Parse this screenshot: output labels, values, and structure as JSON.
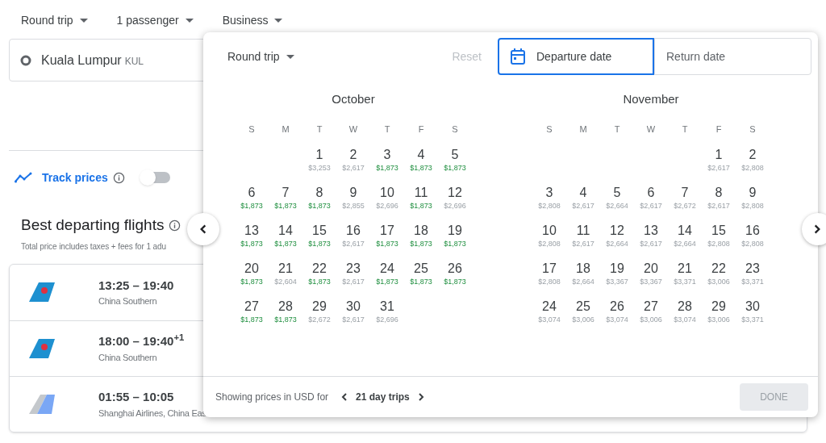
{
  "top_bar": [
    {
      "label": "Round trip"
    },
    {
      "label": "1 passenger"
    },
    {
      "label": "Business"
    }
  ],
  "origin": {
    "city": "Kuala Lumpur",
    "code": "KUL"
  },
  "track_prices": {
    "label": "Track prices",
    "on": false
  },
  "best_flights": {
    "title": "Best departing flights",
    "subtitle": "Total price includes taxes + fees for 1 adu",
    "flights": [
      {
        "times": "13:25 – 19:40",
        "airline": "China Southern",
        "kind": "blue_tail"
      },
      {
        "times": "18:00 – 19:40$^{+1}$",
        "airline": "China Southern",
        "kind": "blue_tail"
      },
      {
        "times": "01:55 – 10:05",
        "airline": "Shanghai Airlines, China Eas",
        "kind": "grey_tail"
      }
    ]
  },
  "date_picker": {
    "trip_type": "Round trip",
    "reset": {
      "label": "Reset",
      "disabled": true
    },
    "fields": [
      {
        "placeholder": "Departure date",
        "selected": true
      },
      {
        "placeholder": "Return date",
        "selected": false
      }
    ],
    "months": [
      {
        "name": "October",
        "weekdays": [
          "S",
          "M",
          "T",
          "W",
          "T",
          "F",
          "S"
        ],
        "weeks": [
          [
            {
              "kind": "blank"
            },
            {
              "kind": "blank"
            },
            {
              "kind": "day",
              "day": "1",
              "price": "$3,253",
              "cheap": false
            },
            {
              "kind": "day",
              "day": "2",
              "price": "$2,617",
              "cheap": false
            },
            {
              "kind": "day",
              "day": "3",
              "price": "$1,873",
              "cheap": true
            },
            {
              "kind": "day",
              "day": "4",
              "price": "$1,873",
              "cheap": true
            },
            {
              "kind": "day",
              "day": "5",
              "price": "$1,873",
              "cheap": true
            }
          ],
          [
            {
              "kind": "day",
              "day": "6",
              "price": "$1,873",
              "cheap": true
            },
            {
              "kind": "day",
              "day": "7",
              "price": "$1,873",
              "cheap": true
            },
            {
              "kind": "day",
              "day": "8",
              "price": "$1,873",
              "cheap": true
            },
            {
              "kind": "day",
              "day": "9",
              "price": "$2,855",
              "cheap": false
            },
            {
              "kind": "day",
              "day": "10",
              "price": "$2,696",
              "cheap": false
            },
            {
              "kind": "day",
              "day": "11",
              "price": "$1,873",
              "cheap": true
            },
            {
              "kind": "day",
              "day": "12",
              "price": "$2,696",
              "cheap": false
            }
          ],
          [
            {
              "kind": "day",
              "day": "13",
              "price": "$1,873",
              "cheap": true
            },
            {
              "kind": "day",
              "day": "14",
              "price": "$1,873",
              "cheap": true
            },
            {
              "kind": "day",
              "day": "15",
              "price": "$1,873",
              "cheap": true
            },
            {
              "kind": "day",
              "day": "16",
              "price": "$2,617",
              "cheap": false
            },
            {
              "kind": "day",
              "day": "17",
              "price": "$1,873",
              "cheap": true
            },
            {
              "kind": "day",
              "day": "18",
              "price": "$1,873",
              "cheap": true
            },
            {
              "kind": "day",
              "day": "19",
              "price": "$1,873",
              "cheap": true
            }
          ],
          [
            {
              "kind": "day",
              "day": "20",
              "price": "$1,873",
              "cheap": true
            },
            {
              "kind": "day",
              "day": "21",
              "price": "$2,604",
              "cheap": false
            },
            {
              "kind": "day",
              "day": "22",
              "price": "$1,873",
              "cheap": true
            },
            {
              "kind": "day",
              "day": "23",
              "price": "$2,617",
              "cheap": false
            },
            {
              "kind": "day",
              "day": "24",
              "price": "$1,873",
              "cheap": true
            },
            {
              "kind": "day",
              "day": "25",
              "price": "$1,873",
              "cheap": true
            },
            {
              "kind": "day",
              "day": "26",
              "price": "$1,873",
              "cheap": true
            }
          ],
          [
            {
              "kind": "day",
              "day": "27",
              "price": "$1,873",
              "cheap": true
            },
            {
              "kind": "day",
              "day": "28",
              "price": "$1,873",
              "cheap": true
            },
            {
              "kind": "day",
              "day": "29",
              "price": "$2,672",
              "cheap": false
            },
            {
              "kind": "day",
              "day": "30",
              "price": "$2,617",
              "cheap": false
            },
            {
              "kind": "day",
              "day": "31",
              "price": "$2,696",
              "cheap": false
            }
          ]
        ]
      },
      {
        "name": "November",
        "weekdays": [
          "S",
          "M",
          "T",
          "W",
          "T",
          "F",
          "S"
        ],
        "weeks": [
          [
            {
              "kind": "blank"
            },
            {
              "kind": "blank"
            },
            {
              "kind": "blank"
            },
            {
              "kind": "blank"
            },
            {
              "kind": "blank"
            },
            {
              "kind": "day",
              "day": "1",
              "price": "$2,617",
              "cheap": false
            },
            {
              "kind": "day",
              "day": "2",
              "price": "$2,808",
              "cheap": false
            }
          ],
          [
            {
              "kind": "day",
              "day": "3",
              "price": "$2,808",
              "cheap": false
            },
            {
              "kind": "day",
              "day": "4",
              "price": "$2,617",
              "cheap": false
            },
            {
              "kind": "day",
              "day": "5",
              "price": "$2,664",
              "cheap": false
            },
            {
              "kind": "day",
              "day": "6",
              "price": "$2,617",
              "cheap": false
            },
            {
              "kind": "day",
              "day": "7",
              "price": "$2,672",
              "cheap": false
            },
            {
              "kind": "day",
              "day": "8",
              "price": "$2,617",
              "cheap": false
            },
            {
              "kind": "day",
              "day": "9",
              "price": "$2,808",
              "cheap": false
            }
          ],
          [
            {
              "kind": "day",
              "day": "10",
              "price": "$2,808",
              "cheap": false
            },
            {
              "kind": "day",
              "day": "11",
              "price": "$2,617",
              "cheap": false
            },
            {
              "kind": "day",
              "day": "12",
              "price": "$2,664",
              "cheap": false
            },
            {
              "kind": "day",
              "day": "13",
              "price": "$2,617",
              "cheap": false
            },
            {
              "kind": "day",
              "day": "14",
              "price": "$2,664",
              "cheap": false
            },
            {
              "kind": "day",
              "day": "15",
              "price": "$2,808",
              "cheap": false
            },
            {
              "kind": "day",
              "day": "16",
              "price": "$2,808",
              "cheap": false
            }
          ],
          [
            {
              "kind": "day",
              "day": "17",
              "price": "$2,808",
              "cheap": false
            },
            {
              "kind": "day",
              "day": "18",
              "price": "$2,664",
              "cheap": false
            },
            {
              "kind": "day",
              "day": "19",
              "price": "$3,367",
              "cheap": false
            },
            {
              "kind": "day",
              "day": "20",
              "price": "$3,367",
              "cheap": false
            },
            {
              "kind": "day",
              "day": "21",
              "price": "$3,371",
              "cheap": false
            },
            {
              "kind": "day",
              "day": "22",
              "price": "$3,006",
              "cheap": false
            },
            {
              "kind": "day",
              "day": "23",
              "price": "$3,371",
              "cheap": false
            }
          ],
          [
            {
              "kind": "day",
              "day": "24",
              "price": "$3,074",
              "cheap": false
            },
            {
              "kind": "day",
              "day": "25",
              "price": "$3,006",
              "cheap": false
            },
            {
              "kind": "day",
              "day": "26",
              "price": "$3,074",
              "cheap": false
            },
            {
              "kind": "day",
              "day": "27",
              "price": "$3,006",
              "cheap": false
            },
            {
              "kind": "day",
              "day": "28",
              "price": "$3,074",
              "cheap": false
            },
            {
              "kind": "day",
              "day": "29",
              "price": "$3,006",
              "cheap": false
            },
            {
              "kind": "day",
              "day": "30",
              "price": "$3,371",
              "cheap": false
            }
          ]
        ]
      }
    ],
    "footer": {
      "label": "Showing prices in USD for",
      "trip_length": "21 day trips",
      "done": {
        "label": "DONE",
        "disabled": true
      }
    }
  }
}
